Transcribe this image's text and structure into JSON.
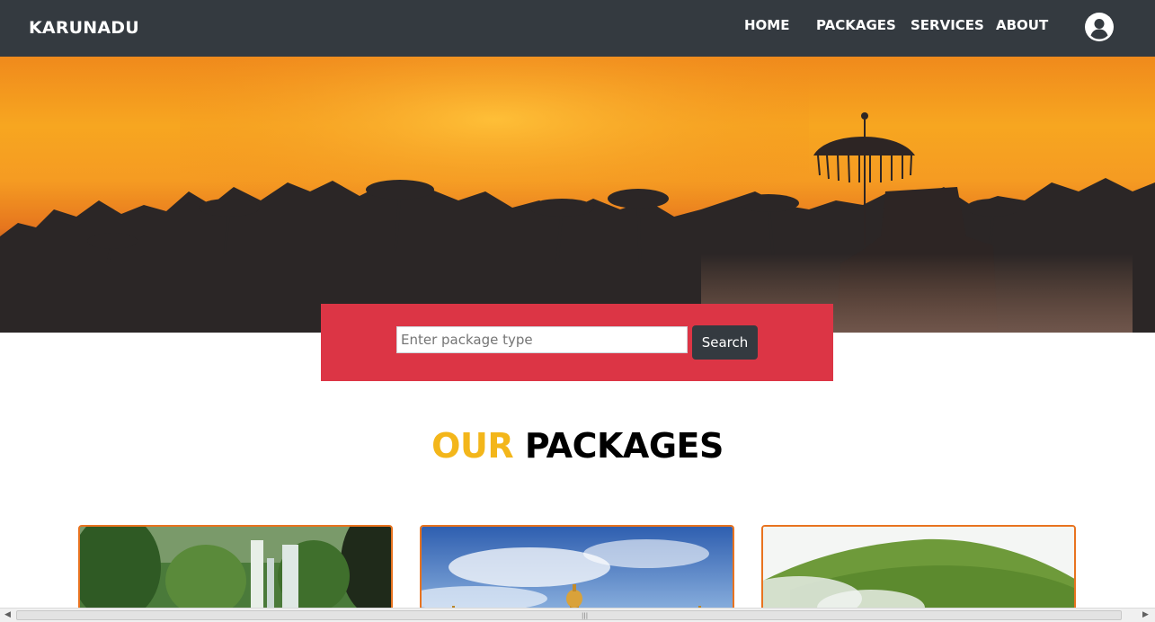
{
  "brand": "KARUNADU",
  "nav": {
    "home": "HOME",
    "packages": "PACKAGES",
    "services": "SERVICES",
    "about": "ABOUT"
  },
  "search": {
    "placeholder": "Enter package type",
    "value": "",
    "button": "Search"
  },
  "section": {
    "title_accent": "OUR",
    "title_main": "PACKAGES"
  },
  "cards": [
    {
      "image": "waterfall-forest"
    },
    {
      "image": "palace-under-blue-sky"
    },
    {
      "image": "misty-green-hill"
    }
  ],
  "colors": {
    "navbar": "#343a40",
    "search_panel": "#dc3545",
    "title_accent": "#f3b61a",
    "card_border": "#e8731f"
  },
  "icons": {
    "profile": "user-circle-icon"
  }
}
